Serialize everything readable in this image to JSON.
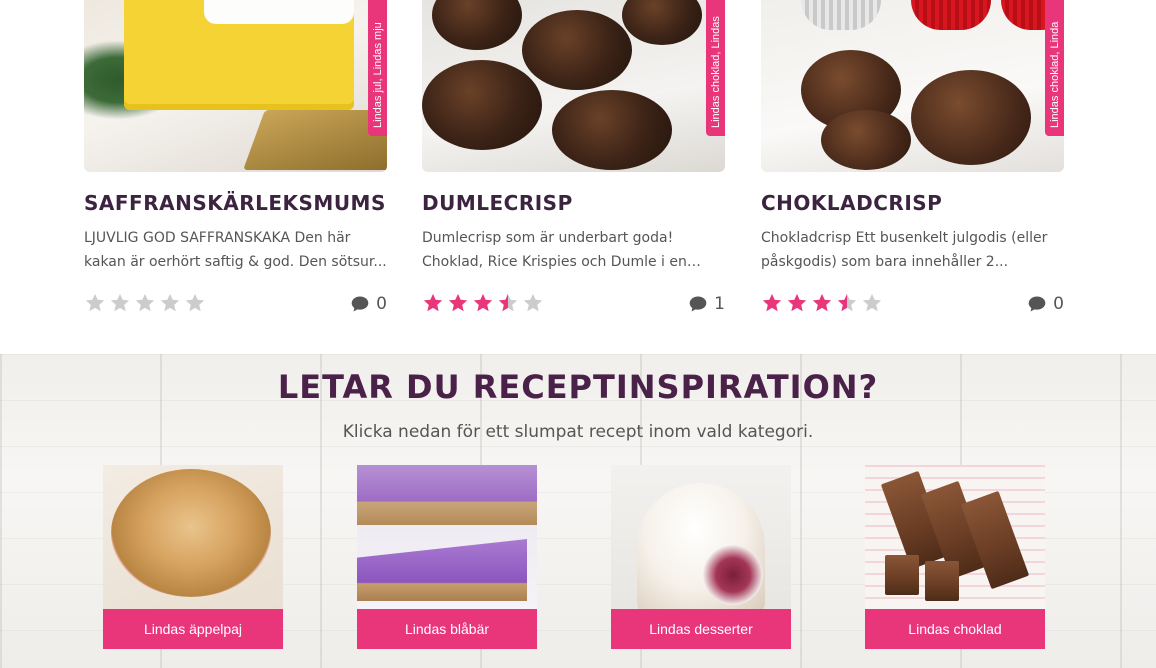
{
  "recipes": [
    {
      "title": "SAFFRANSKÄRLEKSMUMS",
      "tag": "Lindas jul, Lindas mju",
      "description": "LJUVLIG GOD SAFFRANSKAKA Den här kakan är oerhört saftig & god. Den sötsur...",
      "rating": 0,
      "comments": "0"
    },
    {
      "title": "DUMLECRISP",
      "tag": "Lindas choklad, Lindas",
      "description": "Dumlecrisp som är underbart goda! Choklad, Rice Krispies och Dumle i en och...",
      "rating": 3.5,
      "comments": "1"
    },
    {
      "title": "CHOKLADCRISP",
      "tag": "Lindas choklad, Linda",
      "description": "Chokladcrisp Ett busenkelt julgodis (eller påskgodis) som bara innehåller 2...",
      "rating": 3.5,
      "comments": "0"
    }
  ],
  "inspiration": {
    "title": "LETAR DU RECEPTINSPIRATION?",
    "subtitle": "Klicka nedan för ett slumpat recept inom vald kategori.",
    "categories": [
      {
        "label": "Lindas äppelpaj"
      },
      {
        "label": "Lindas blåbär"
      },
      {
        "label": "Lindas desserter"
      },
      {
        "label": "Lindas choklad"
      }
    ]
  },
  "colors": {
    "accent": "#e9367a",
    "title": "#3c2340",
    "heading": "#4a2148",
    "star_filled": "#e9367a",
    "star_empty": "#cccccc",
    "comment_icon": "#555555"
  },
  "icons": {
    "star": "star-icon",
    "comment": "comment-bubble-icon"
  }
}
